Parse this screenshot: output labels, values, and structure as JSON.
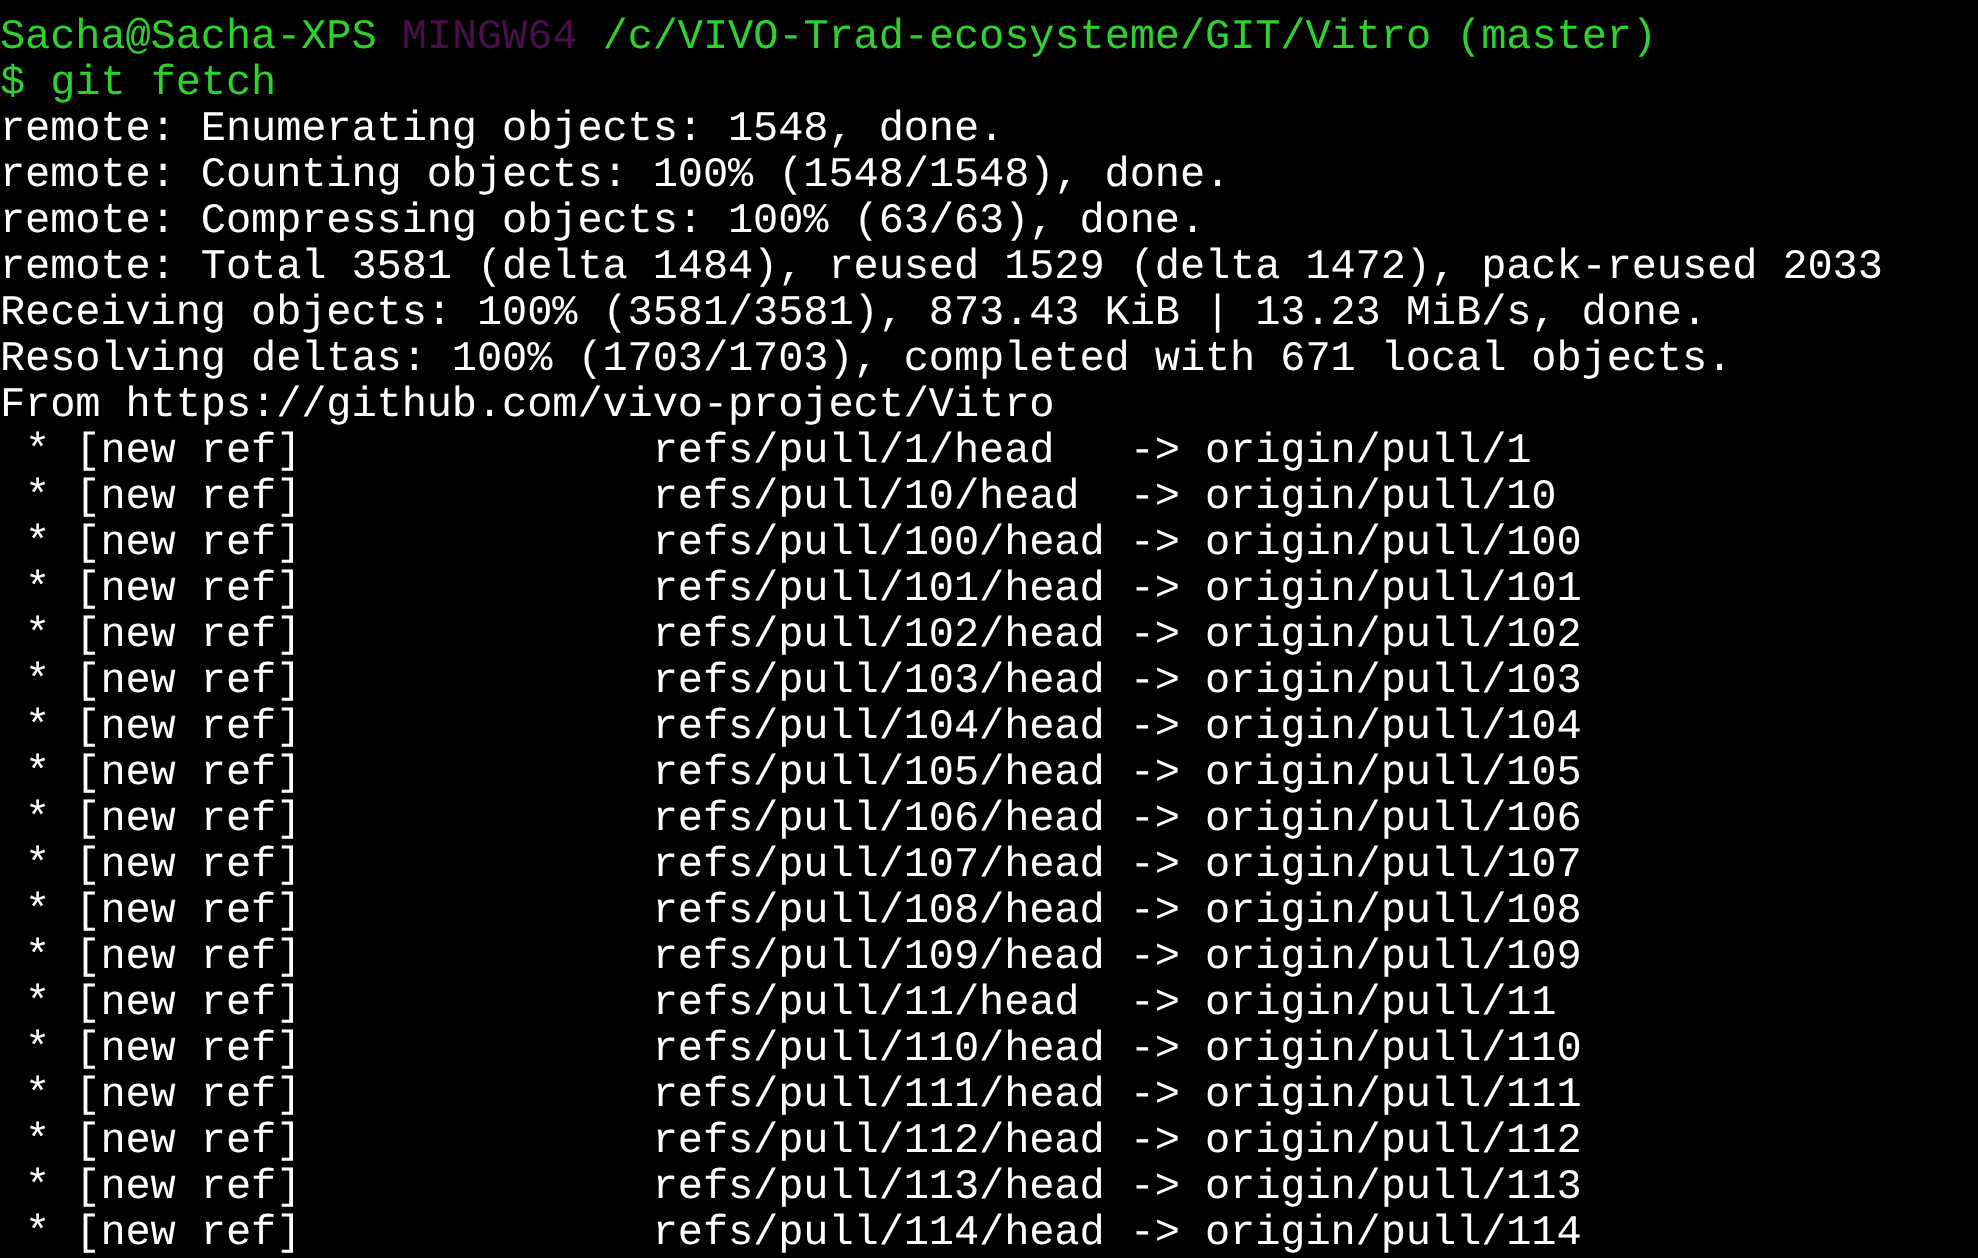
{
  "prompt": {
    "user_host": "Sacha@Sacha-XPS",
    "system": "MINGW64",
    "path": "/c/VIVO-Trad-ecosysteme/GIT/Vitro",
    "branch": "(master)"
  },
  "command": {
    "symbol": "$",
    "text": "git fetch"
  },
  "output": [
    "remote: Enumerating objects: 1548, done.",
    "remote: Counting objects: 100% (1548/1548), done.",
    "remote: Compressing objects: 100% (63/63), done.",
    "remote: Total 3581 (delta 1484), reused 1529 (delta 1472), pack-reused 2033",
    "Receiving objects: 100% (3581/3581), 873.43 KiB | 13.23 MiB/s, done.",
    "Resolving deltas: 100% (1703/1703), completed with 671 local objects.",
    "From https://github.com/vivo-project/Vitro",
    " * [new ref]              refs/pull/1/head   -> origin/pull/1",
    " * [new ref]              refs/pull/10/head  -> origin/pull/10",
    " * [new ref]              refs/pull/100/head -> origin/pull/100",
    " * [new ref]              refs/pull/101/head -> origin/pull/101",
    " * [new ref]              refs/pull/102/head -> origin/pull/102",
    " * [new ref]              refs/pull/103/head -> origin/pull/103",
    " * [new ref]              refs/pull/104/head -> origin/pull/104",
    " * [new ref]              refs/pull/105/head -> origin/pull/105",
    " * [new ref]              refs/pull/106/head -> origin/pull/106",
    " * [new ref]              refs/pull/107/head -> origin/pull/107",
    " * [new ref]              refs/pull/108/head -> origin/pull/108",
    " * [new ref]              refs/pull/109/head -> origin/pull/109",
    " * [new ref]              refs/pull/11/head  -> origin/pull/11",
    " * [new ref]              refs/pull/110/head -> origin/pull/110",
    " * [new ref]              refs/pull/111/head -> origin/pull/111",
    " * [new ref]              refs/pull/112/head -> origin/pull/112",
    " * [new ref]              refs/pull/113/head -> origin/pull/113",
    " * [new ref]              refs/pull/114/head -> origin/pull/114"
  ]
}
